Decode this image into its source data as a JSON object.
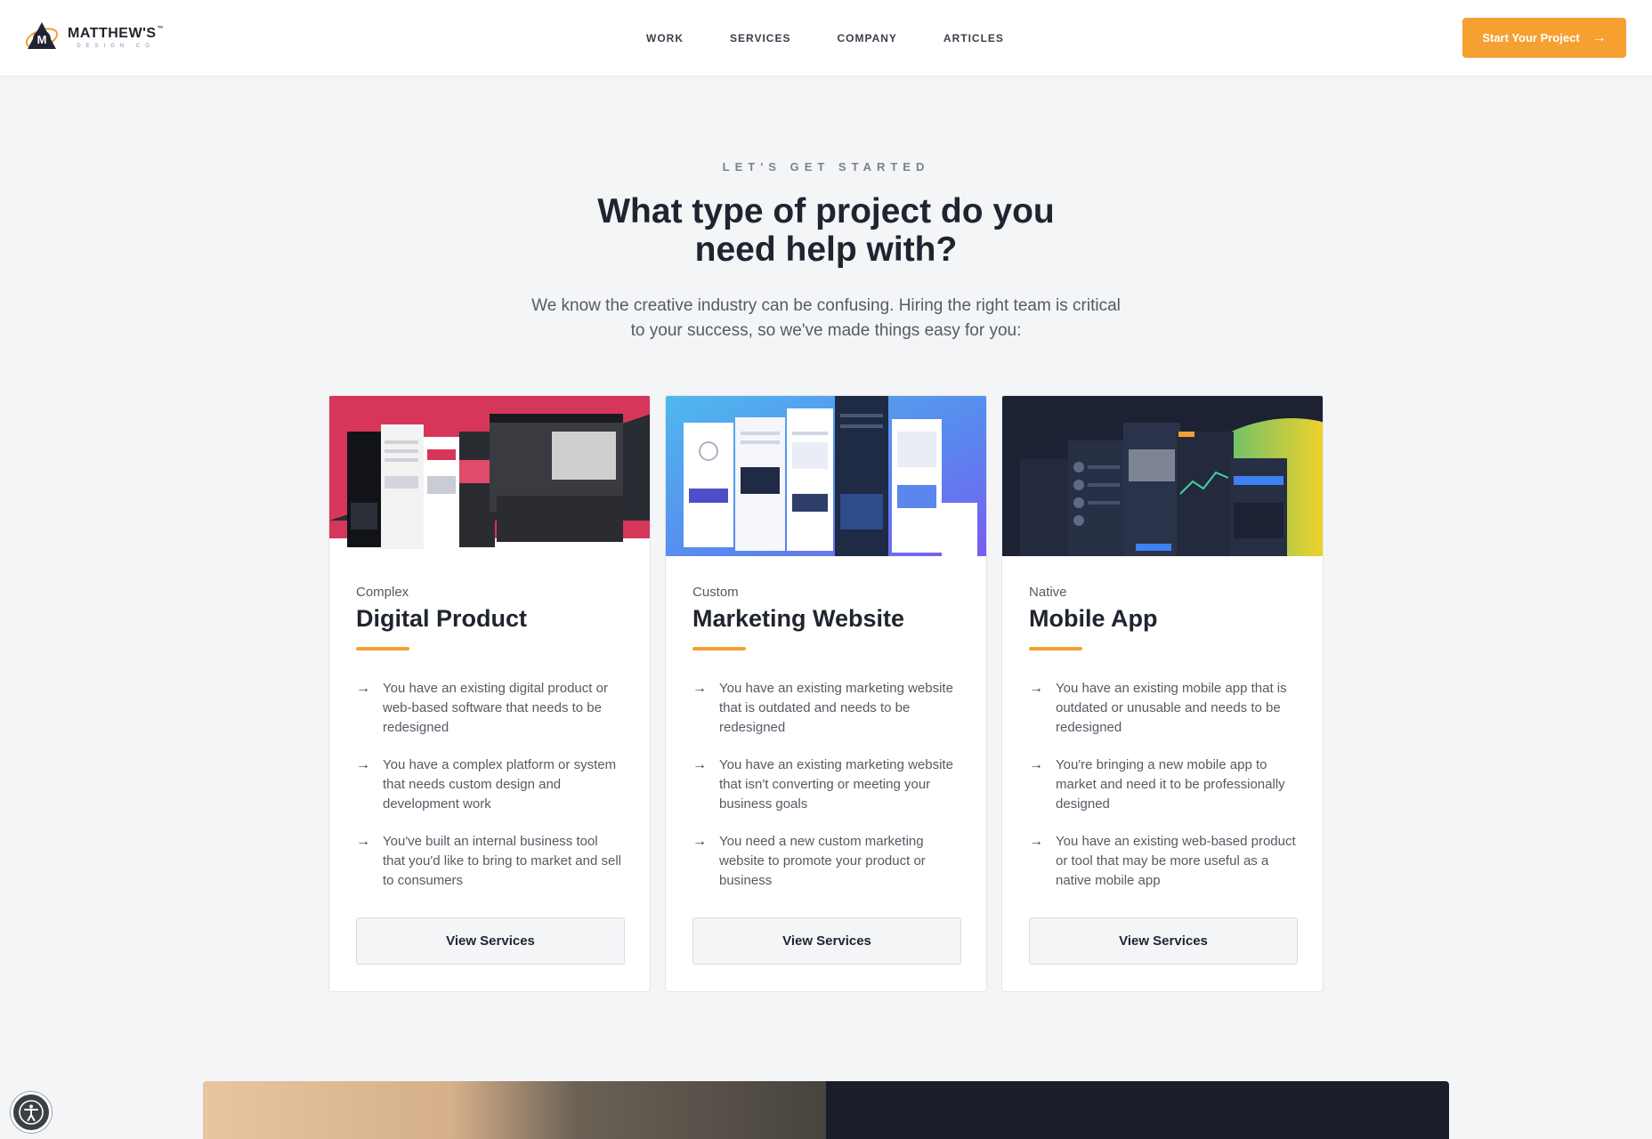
{
  "brand": {
    "name": "MATTHEW'S",
    "trademark": "™",
    "tagline": "DESIGN CO",
    "logo_letter": "M"
  },
  "nav": {
    "items": [
      {
        "label": "WORK"
      },
      {
        "label": "SERVICES"
      },
      {
        "label": "COMPANY"
      },
      {
        "label": "ARTICLES"
      }
    ]
  },
  "cta": {
    "label": "Start Your Project",
    "icon": "arrow-right-icon"
  },
  "hero": {
    "eyebrow": "LET'S GET STARTED",
    "heading": "What type of project do you need help with?",
    "lead": "We know the creative industry can be confusing. Hiring the right team is critical to your success, so we've made things easy for you:"
  },
  "cards": [
    {
      "kicker": "Complex",
      "title": "Digital Product",
      "items": [
        "You have an existing digital product or web-based software that needs to be redesigned",
        "You have a complex platform or system that needs custom design and development work",
        "You've built an internal business tool that you'd like to bring to market and sell to consumers"
      ],
      "button": "View Services"
    },
    {
      "kicker": "Custom",
      "title": "Marketing Website",
      "items": [
        "You have an existing marketing website that is outdated and needs to be redesigned",
        "You have an existing marketing website that isn't converting or meeting your business goals",
        "You need a new custom marketing website to promote your product or business"
      ],
      "button": "View Services"
    },
    {
      "kicker": "Native",
      "title": "Mobile App",
      "items": [
        "You have an existing mobile app that is outdated or unusable and needs to be redesigned",
        "You're bringing a new mobile app to market and need it to be professionally designed",
        "You have an existing web-based product or tool that may be more useful as a native mobile app"
      ],
      "button": "View Services"
    }
  ],
  "colors": {
    "accent": "#f5a031",
    "text_dark": "#1f2430",
    "background": "#f4f5f7"
  },
  "accessibility_widget": {
    "icon": "accessibility-icon"
  }
}
